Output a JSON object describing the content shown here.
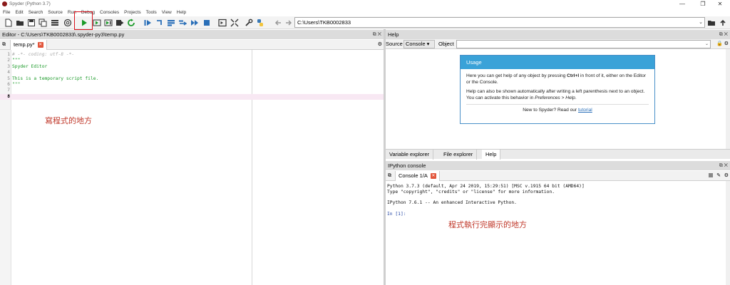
{
  "window": {
    "title": "Spyder (Python 3.7)",
    "controls": {
      "minimize": "—",
      "maximize": "❐",
      "close": "✕"
    }
  },
  "menubar": {
    "items": [
      "File",
      "Edit",
      "Search",
      "Source",
      "Run",
      "Debug",
      "Consoles",
      "Projects",
      "Tools",
      "View",
      "Help"
    ]
  },
  "toolbar": {
    "current_path": "C:\\Users\\TKB0002833",
    "dropdown_caret": "⌄",
    "colors": {
      "run_green": "#1a9a28",
      "stop_blue": "#2a6fb8",
      "highlight_red": "#d9121c"
    }
  },
  "editor": {
    "header_title": "Editor - C:\\Users\\TKB0002833\\.spyder-py3\\temp.py",
    "header_buttons": "⧉ ✕",
    "tab_label": "temp.py*",
    "lines": [
      {
        "num": "1",
        "text": "# -*- coding: utf-8 -*-",
        "kind": "comment"
      },
      {
        "num": "2",
        "text": "\"\"\"",
        "kind": "string"
      },
      {
        "num": "3",
        "text": "Spyder Editor",
        "kind": "string"
      },
      {
        "num": "4",
        "text": "",
        "kind": "string"
      },
      {
        "num": "5",
        "text": "This is a temporary script file.",
        "kind": "string"
      },
      {
        "num": "6",
        "text": "\"\"\"",
        "kind": "string"
      },
      {
        "num": "7",
        "text": "",
        "kind": "plain"
      },
      {
        "num": "8",
        "text": "",
        "kind": "current"
      }
    ],
    "annotation": "寫程式的地方"
  },
  "help": {
    "header_title": "Help",
    "header_buttons": "⧉ ✕",
    "source_label": "Source",
    "source_value": "Console",
    "object_label": "Object",
    "usage": {
      "title": "Usage",
      "para1_a": "Here you can get help of any object by pressing ",
      "para1_key": "Ctrl+I",
      "para1_b": " in front of it, either on the Editor or the Console.",
      "para2_a": "Help can also be shown automatically after writing a left parenthesis next to an object. You can activate this behavior in ",
      "para2_pref": "Preferences > Help",
      "para2_b": ".",
      "footer_text": "New to Spyder? Read our ",
      "footer_link": "tutorial"
    },
    "lower_tabs": [
      "Variable explorer",
      "File explorer",
      "Help"
    ]
  },
  "console": {
    "header_title": "IPython console",
    "header_buttons": "⧉ ✕",
    "tab_label": "Console 1/A",
    "lines": [
      "Python 3.7.3 (default, Apr 24 2019, 15:29:51) [MSC v.1915 64 bit (AMD64)]",
      "Type \"copyright\", \"credits\" or \"license\" for more information.",
      "",
      "IPython 7.6.1 -- An enhanced Interactive Python.",
      ""
    ],
    "prompt": "In [1]:",
    "annotation": "程式執行完顯示的地方"
  }
}
